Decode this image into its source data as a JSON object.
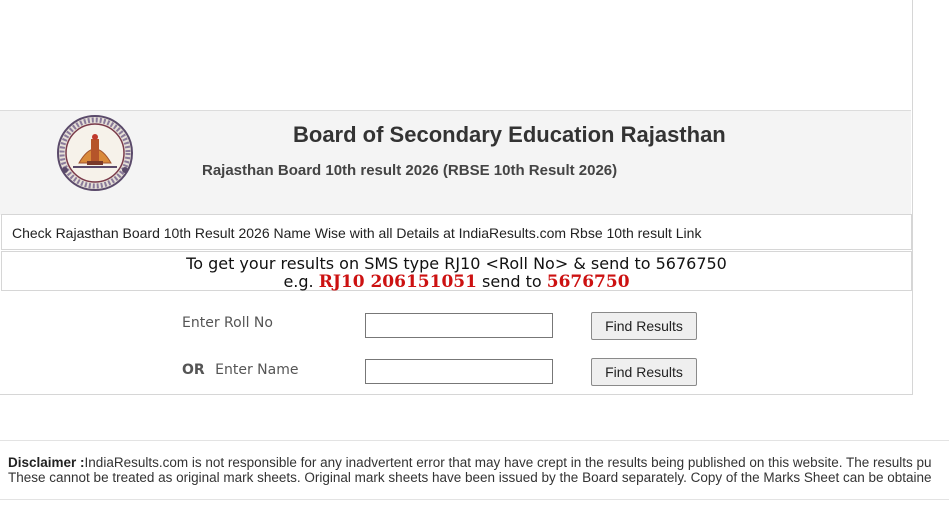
{
  "header": {
    "title": "Board of Secondary Education Rajasthan",
    "subtitle": "Rajasthan Board 10th result 2026 (RBSE 10th Result 2026)",
    "logo_icon": "rbse-seal-logo-icon"
  },
  "info": {
    "text": "Check Rajasthan Board 10th Result 2026 Name Wise with all Details at IndiaResults.com Rbse 10th result Link"
  },
  "sms": {
    "line1": "To get your results on SMS type RJ10 <Roll No> & send to 5676750",
    "line2_prefix": "e.g. ",
    "example_code": "RJ10 206151051",
    "line2_mid": " send to ",
    "example_number": "5676750"
  },
  "form": {
    "roll_label": "Enter Roll No",
    "roll_value": "",
    "or_label": "OR",
    "name_label": "Enter Name",
    "name_value": "",
    "find_button": "Find Results"
  },
  "disclaimer": {
    "label": "Disclaimer :",
    "line1": "IndiaResults.com is not responsible for any inadvertent error that may have crept in the results being published on this website. The results pu",
    "line2": "These cannot be treated as original mark sheets. Original mark sheets have been issued by the Board separately. Copy of the Marks Sheet can be obtaine"
  },
  "colors": {
    "accent_red": "#cc1111",
    "header_bg": "#f4f4f4"
  }
}
